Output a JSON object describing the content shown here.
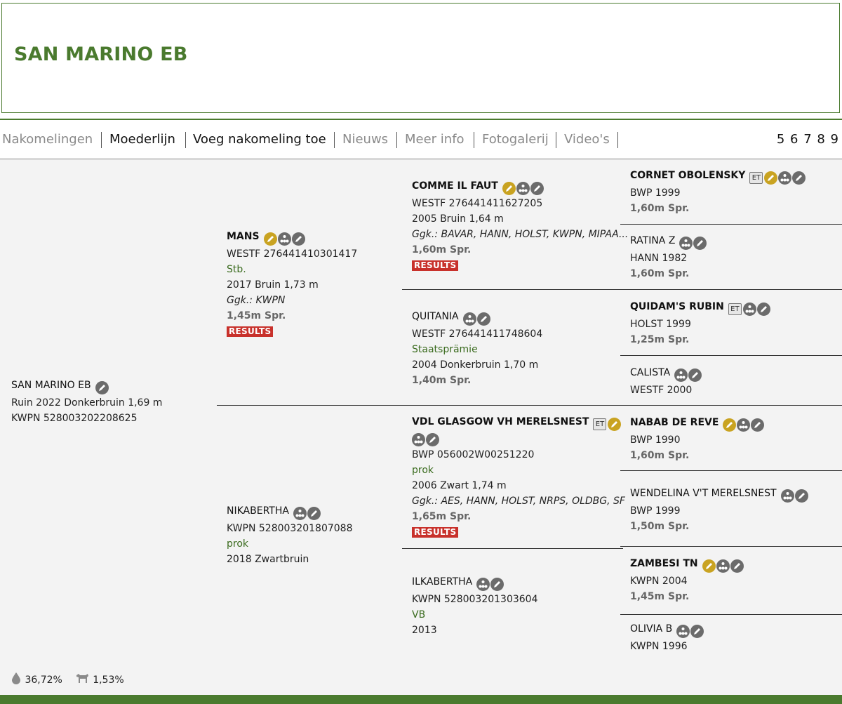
{
  "page": {
    "title": "SAN MARINO EB"
  },
  "nav": {
    "items": [
      {
        "label": "Nakomelingen",
        "style": "muted"
      },
      {
        "label": "Moederlijn",
        "style": "strong"
      },
      {
        "label": "Voeg nakomeling toe",
        "style": "strong"
      },
      {
        "label": "Nieuws",
        "style": "muted"
      },
      {
        "label": "Meer info",
        "style": "muted"
      },
      {
        "label": "Fotogalerij",
        "style": "muted"
      },
      {
        "label": "Video's",
        "style": "muted"
      }
    ],
    "pages": "5 6 7 8 9"
  },
  "colors": {
    "brand_green": "#4a7a2e",
    "results_red": "#c8312b",
    "icon_gold": "#c9a321",
    "icon_grey": "#6b6b6b"
  },
  "subject": {
    "name": "SAN MARINO EB",
    "line1": "Ruin 2022 Donkerbruin 1,69 m",
    "line2": "KWPN 528003202208625"
  },
  "sire": {
    "name": "MANS",
    "reg": "WESTF 276441410301417",
    "status": "Stb.",
    "info": "2017 Bruin 1,73 m",
    "ggk": "Ggk.: KWPN",
    "spr": "1,45m Spr.",
    "results": "RESULTS"
  },
  "dam": {
    "name": "NIKABERTHA",
    "reg": "KWPN 528003201807088",
    "status": "prok",
    "info": "2018 Zwartbruin"
  },
  "ss": {
    "name": "COMME IL FAUT",
    "reg": "WESTF 276441411627205",
    "info": "2005 Bruin 1,64 m",
    "ggk": "Ggk.: BAVAR, HANN, HOLST, KWPN, MIPAA...",
    "spr": "1,60m Spr.",
    "results": "RESULTS"
  },
  "sd": {
    "name": "QUITANIA",
    "reg": "WESTF 276441411748604",
    "status": "Staatsprämie",
    "info": "2004 Donkerbruin 1,70 m",
    "spr": "1,40m Spr."
  },
  "ds": {
    "name": "VDL GLASGOW VH MERELSNEST",
    "et": "ET",
    "reg": "BWP 056002W00251220",
    "status": "prok",
    "info": "2006 Zwart 1,74 m",
    "ggk": "Ggk.: AES, HANN, HOLST, NRPS, OLDBG, SF",
    "spr": "1,65m Spr.",
    "results": "RESULTS"
  },
  "dd": {
    "name": "ILKABERTHA",
    "reg": "KWPN 528003201303604",
    "status": "VB",
    "info": "2013"
  },
  "g1": {
    "name": "CORNET OBOLENSKY",
    "et": "ET",
    "info": "BWP 1999",
    "spr": "1,60m Spr."
  },
  "g2": {
    "name": "RATINA Z",
    "info": "HANN 1982",
    "spr": "1,60m Spr."
  },
  "g3": {
    "name": "QUIDAM'S RUBIN",
    "et": "ET",
    "info": "HOLST 1999",
    "spr": "1,25m Spr."
  },
  "g4": {
    "name": "CALISTA",
    "info": "WESTF 2000"
  },
  "g5": {
    "name": "NABAB DE REVE",
    "info": "BWP 1990",
    "spr": "1,60m Spr."
  },
  "g6": {
    "name": "WENDELINA V'T MERELSNEST",
    "info": "BWP 1999",
    "spr": "1,50m Spr."
  },
  "g7": {
    "name": "ZAMBESI TN",
    "info": "KWPN 2004",
    "spr": "1,45m Spr."
  },
  "g8": {
    "name": "OLIVIA B",
    "info": "KWPN 1996"
  },
  "stats": {
    "blood_pct": "36,72%",
    "horse_pct": "1,53%",
    "blood_icon": "drop-icon",
    "horse_icon": "horse-icon"
  }
}
